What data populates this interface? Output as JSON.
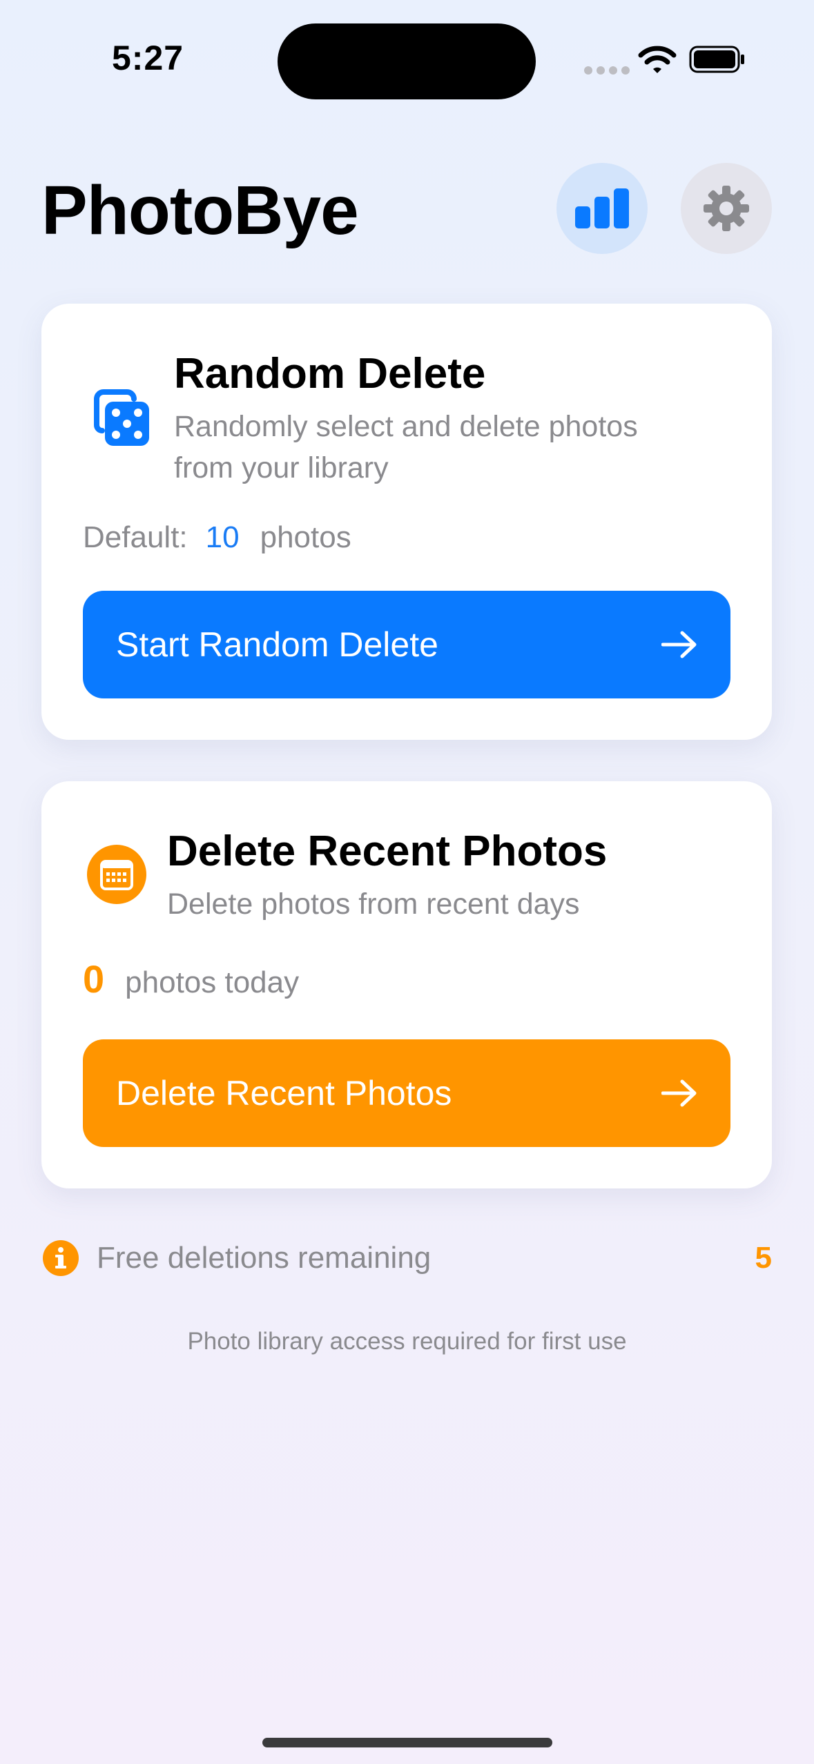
{
  "status_bar": {
    "time": "5:27"
  },
  "header": {
    "title": "PhotoBye",
    "stats_icon": "bar-chart-icon",
    "settings_icon": "gear-icon"
  },
  "random_delete": {
    "icon": "dice-icon",
    "title": "Random Delete",
    "description_line1": "Randomly select and delete photos",
    "description_line2": "from your library",
    "default_label": "Default:",
    "default_value": "10",
    "default_unit": "photos",
    "button_label": "Start Random Delete",
    "button_icon": "arrow-right-icon"
  },
  "recent_delete": {
    "icon": "calendar-icon",
    "title": "Delete Recent Photos",
    "description": "Delete photos from recent days",
    "count": "0",
    "count_label": "photos today",
    "button_label": "Delete Recent Photos",
    "button_icon": "arrow-right-icon"
  },
  "free_deletions": {
    "icon": "info-icon",
    "label": "Free deletions remaining",
    "count": "5"
  },
  "footer_note": "Photo library access required for first use",
  "colors": {
    "accent_blue": "#0a7aff",
    "accent_orange": "#ff9500",
    "secondary_text": "#8a8a8e"
  }
}
